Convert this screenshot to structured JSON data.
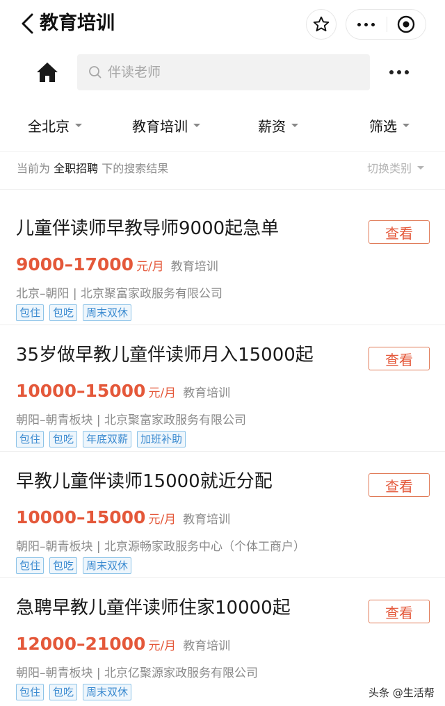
{
  "nav": {
    "title": "教育培训"
  },
  "search": {
    "placeholder": "伴读老师"
  },
  "filters": [
    {
      "label": "全北京"
    },
    {
      "label": "教育培训"
    },
    {
      "label": "薪资"
    },
    {
      "label": "筛选"
    }
  ],
  "context": {
    "prefix": "当前为",
    "category": "全职招聘",
    "suffix": "下的搜索结果",
    "switch_label": "切换类别"
  },
  "view_label": "查看",
  "jobs": [
    {
      "title": "儿童伴读师早教导师9000起急单",
      "salary": "9000–17000",
      "unit": "元/月",
      "category": "教育培训",
      "location": "北京–朝阳",
      "company": "北京聚富家政服务有限公司",
      "tags": [
        "包住",
        "包吃",
        "周末双休"
      ]
    },
    {
      "title": "35岁做早教儿童伴读师月入15000起",
      "salary": "10000–15000",
      "unit": "元/月",
      "category": "教育培训",
      "location": "朝阳–朝青板块",
      "company": "北京聚富家政服务有限公司",
      "tags": [
        "包住",
        "包吃",
        "年底双薪",
        "加班补助"
      ]
    },
    {
      "title": "早教儿童伴读师15000就近分配",
      "salary": "10000–15000",
      "unit": "元/月",
      "category": "教育培训",
      "location": "朝阳–朝青板块",
      "company": "北京源畅家政服务中心（个体工商户）",
      "tags": [
        "包住",
        "包吃",
        "周末双休"
      ]
    },
    {
      "title": "急聘早教儿童伴读师住家10000起",
      "salary": "12000–21000",
      "unit": "元/月",
      "category": "教育培训",
      "location": "朝阳–朝青板块",
      "company": "北京亿聚源家政服务有限公司",
      "tags": [
        "包住",
        "包吃",
        "周末双休"
      ]
    }
  ],
  "watermark": "头条 @生活帮",
  "colors": {
    "accent": "#e4583a",
    "tag_blue": "#3a8ad0"
  }
}
